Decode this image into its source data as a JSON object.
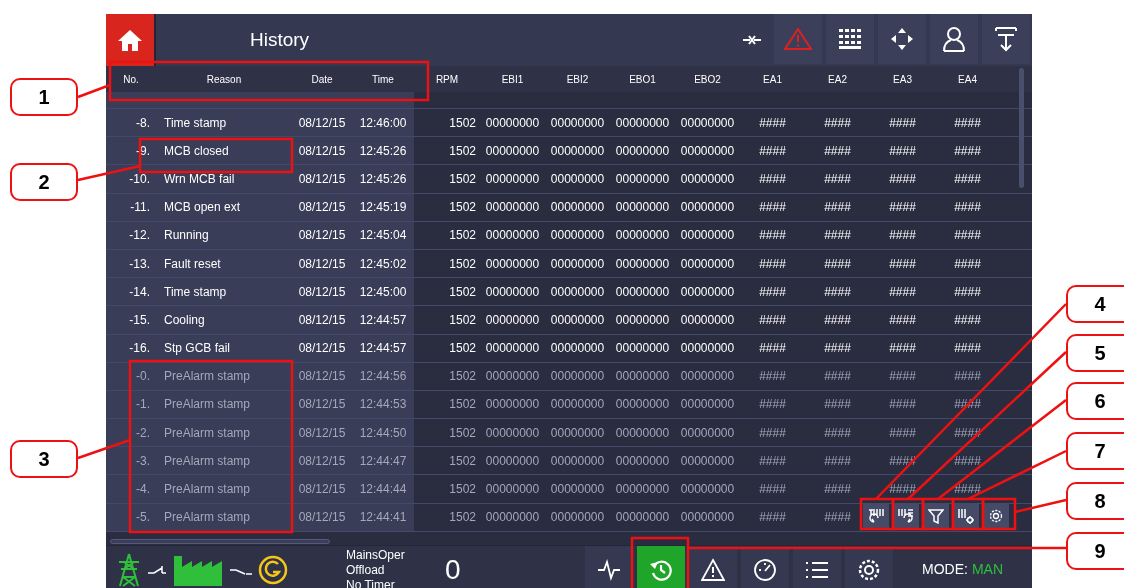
{
  "title": "History",
  "columns": [
    "No.",
    "Reason",
    "Date",
    "Time",
    "RPM",
    "EBI1",
    "EBI2",
    "EBO1",
    "EBO2",
    "EA1",
    "EA2",
    "EA3",
    "EA4"
  ],
  "rows": [
    {
      "kind": "event",
      "cells": [
        "-8.",
        "Time stamp",
        "08/12/15",
        "12:46:00",
        "1502",
        "00000000",
        "00000000",
        "00000000",
        "00000000",
        "####",
        "####",
        "####",
        "####"
      ]
    },
    {
      "kind": "event",
      "cells": [
        "-9.",
        "MCB closed",
        "08/12/15",
        "12:45:26",
        "1502",
        "00000000",
        "00000000",
        "00000000",
        "00000000",
        "####",
        "####",
        "####",
        "####"
      ]
    },
    {
      "kind": "event",
      "cells": [
        "-10.",
        "Wrn MCB fail",
        "08/12/15",
        "12:45:26",
        "1502",
        "00000000",
        "00000000",
        "00000000",
        "00000000",
        "####",
        "####",
        "####",
        "####"
      ]
    },
    {
      "kind": "event",
      "cells": [
        "-11.",
        "MCB open ext",
        "08/12/15",
        "12:45:19",
        "1502",
        "00000000",
        "00000000",
        "00000000",
        "00000000",
        "####",
        "####",
        "####",
        "####"
      ]
    },
    {
      "kind": "event",
      "cells": [
        "-12.",
        "Running",
        "08/12/15",
        "12:45:04",
        "1502",
        "00000000",
        "00000000",
        "00000000",
        "00000000",
        "####",
        "####",
        "####",
        "####"
      ]
    },
    {
      "kind": "event",
      "cells": [
        "-13.",
        "Fault reset",
        "08/12/15",
        "12:45:02",
        "1502",
        "00000000",
        "00000000",
        "00000000",
        "00000000",
        "####",
        "####",
        "####",
        "####"
      ]
    },
    {
      "kind": "event",
      "cells": [
        "-14.",
        "Time stamp",
        "08/12/15",
        "12:45:00",
        "1502",
        "00000000",
        "00000000",
        "00000000",
        "00000000",
        "####",
        "####",
        "####",
        "####"
      ]
    },
    {
      "kind": "event",
      "cells": [
        "-15.",
        "Cooling",
        "08/12/15",
        "12:44:57",
        "1502",
        "00000000",
        "00000000",
        "00000000",
        "00000000",
        "####",
        "####",
        "####",
        "####"
      ]
    },
    {
      "kind": "event",
      "cells": [
        "-16.",
        "Stp GCB fail",
        "08/12/15",
        "12:44:57",
        "1502",
        "00000000",
        "00000000",
        "00000000",
        "00000000",
        "####",
        "####",
        "####",
        "####"
      ]
    },
    {
      "kind": "prealarm",
      "cells": [
        "-0.",
        "PreAlarm stamp",
        "08/12/15",
        "12:44:56",
        "1502",
        "00000000",
        "00000000",
        "00000000",
        "00000000",
        "####",
        "####",
        "####",
        "####"
      ]
    },
    {
      "kind": "prealarm",
      "cells": [
        "-1.",
        "PreAlarm stamp",
        "08/12/15",
        "12:44:53",
        "1502",
        "00000000",
        "00000000",
        "00000000",
        "00000000",
        "####",
        "####",
        "####",
        "####"
      ]
    },
    {
      "kind": "prealarm",
      "cells": [
        "-2.",
        "PreAlarm stamp",
        "08/12/15",
        "12:44:50",
        "1502",
        "00000000",
        "00000000",
        "00000000",
        "00000000",
        "####",
        "####",
        "####",
        "####"
      ]
    },
    {
      "kind": "prealarm",
      "cells": [
        "-3.",
        "PreAlarm stamp",
        "08/12/15",
        "12:44:47",
        "1502",
        "00000000",
        "00000000",
        "00000000",
        "00000000",
        "####",
        "####",
        "####",
        "####"
      ]
    },
    {
      "kind": "prealarm",
      "cells": [
        "-4.",
        "PreAlarm stamp",
        "08/12/15",
        "12:44:44",
        "1502",
        "00000000",
        "00000000",
        "00000000",
        "00000000",
        "####",
        "####",
        "####",
        "####"
      ]
    },
    {
      "kind": "prealarm",
      "cells": [
        "-5.",
        "PreAlarm stamp",
        "08/12/15",
        "12:44:41",
        "1502",
        "00000000",
        "00000000",
        "00000000",
        "00000000",
        "####",
        "####"
      ]
    }
  ],
  "status_lines": [
    "MainsOper",
    "Offload",
    "No Timer"
  ],
  "counter": "0",
  "nav_buttons": [
    {
      "kind": "waveform",
      "selected": false
    },
    {
      "kind": "history",
      "selected": true
    },
    {
      "kind": "alarm",
      "selected": false
    },
    {
      "kind": "gauge",
      "selected": false
    },
    {
      "kind": "list",
      "selected": false
    },
    {
      "kind": "settings",
      "selected": false
    }
  ],
  "mode": {
    "label": "MODE:",
    "value": "MAN"
  },
  "callouts": [
    "1",
    "2",
    "3",
    "4",
    "5",
    "6",
    "7",
    "8",
    "9"
  ]
}
